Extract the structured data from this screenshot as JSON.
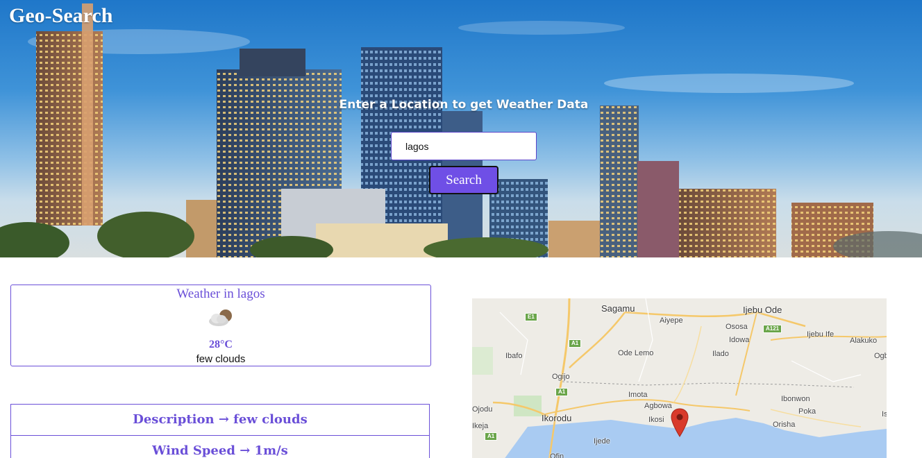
{
  "header": {
    "brand": "Geo-Search",
    "prompt": "Enter a Location to get Weather Data"
  },
  "search": {
    "value": "lagos",
    "button_label": "Search"
  },
  "weather": {
    "title": "Weather in lagos",
    "icon": "few-clouds-icon",
    "temperature": "28°C",
    "description": "few clouds"
  },
  "details": [
    {
      "label": "Description → few clouds"
    },
    {
      "label": "Wind Speed → 1m/s"
    }
  ],
  "map": {
    "labels": {
      "sagamu": "Sagamu",
      "ijebu_ode": "Ijebu Ode",
      "aiyepe": "Aiyepe",
      "ososa": "Ososa",
      "ijebu_ife": "Ijebu Ife",
      "alakuko": "Alakuko",
      "idowa": "Idowa",
      "ibafo": "Ibafo",
      "ode_lemo": "Ode Lemo",
      "ilado": "Ilado",
      "ogb": "Ogb",
      "ogijo": "Ogijo",
      "imota": "Imota",
      "ibonwon": "Ibonwon",
      "ojodu": "Ojodu",
      "agbowa": "Agbowa",
      "ikorodu": "Ikorodu",
      "ikosi": "Ikosi",
      "poka": "Poka",
      "orisha": "Orisha",
      "ikeja": "Ikeja",
      "ijede": "Ijede",
      "ofin": "Ofin",
      "is": "Is"
    },
    "shields": {
      "e1": "E1",
      "a1_north": "A1",
      "a1_mid": "A1",
      "a1_south": "A1",
      "a121": "A121"
    }
  },
  "colors": {
    "accent": "#6a4fd8",
    "button": "#6f4fe6",
    "marker": "#d93a2b"
  }
}
